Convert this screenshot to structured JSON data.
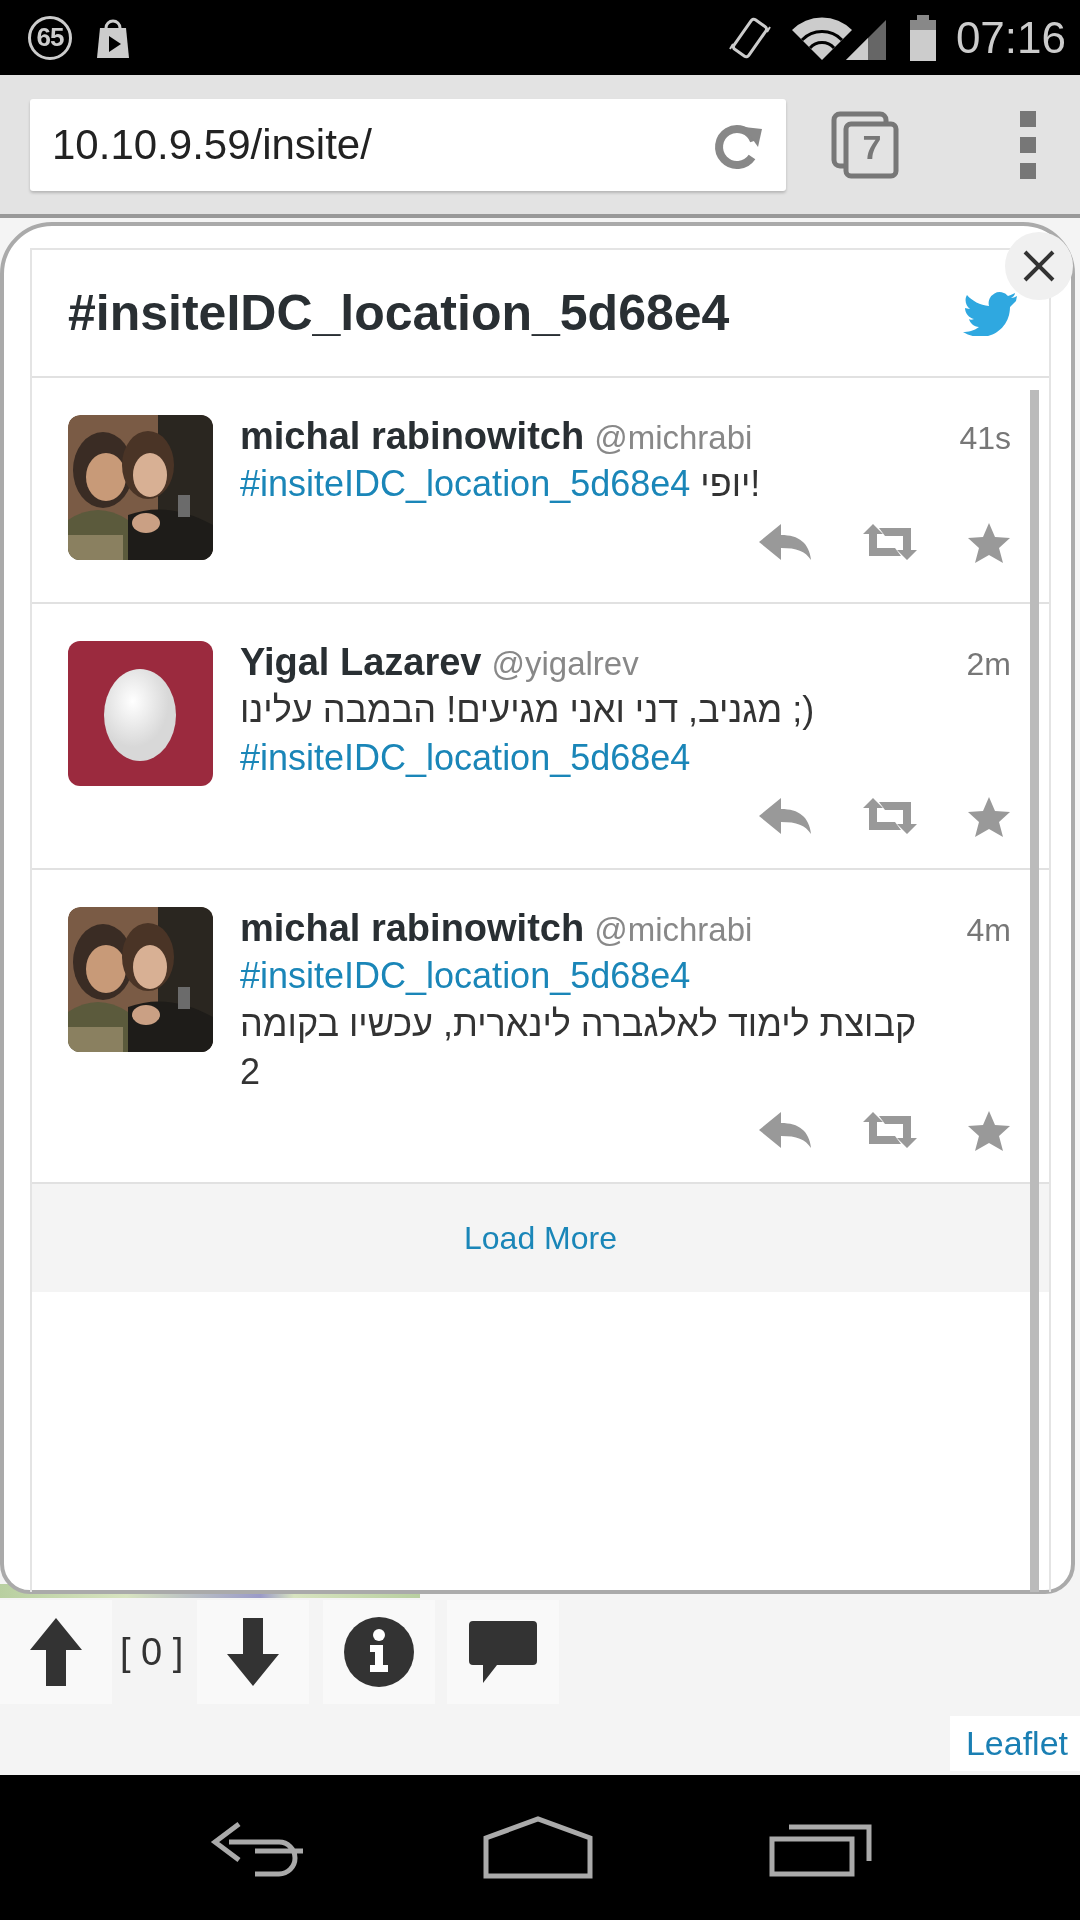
{
  "status_bar": {
    "notification_count": "65",
    "time": "07:16"
  },
  "browser": {
    "url": "10.10.9.59/insite/",
    "tab_count": "7"
  },
  "popup": {
    "title": "#insiteIDC_location_5d68e4",
    "tweets": [
      {
        "author": "michal rabinowitch",
        "handle": "@michrabi",
        "time": "41s",
        "avatar": {
          "kind": "picture"
        },
        "message": [
          {
            "kind": "hashtag",
            "text": "#insiteIDC_location_5d68e4"
          },
          {
            "kind": "text",
            "text": " יופי!"
          }
        ]
      },
      {
        "author": "Yigal Lazarev",
        "handle": "@yigalrev",
        "time": "2m",
        "avatar": {
          "kind": "egg"
        },
        "message": [
          {
            "kind": "text",
            "text": "מגניב, דני ואני מגיעים! הבמבה עלינו ;) "
          },
          {
            "kind": "hashtag",
            "text": "#insiteIDC_location_5d68e4"
          }
        ]
      },
      {
        "author": "michal rabinowitch",
        "handle": "@michrabi",
        "time": "4m",
        "avatar": {
          "kind": "picture"
        },
        "message": [
          {
            "kind": "hashtag",
            "text": "#insiteIDC_location_5d68e4"
          },
          {
            "kind": "text",
            "text": "\n קבוצת לימוד לאלגברה לינארית, עכשיו בקומה 2"
          }
        ]
      }
    ],
    "load_more": "Load More"
  },
  "map_controls": {
    "counter": "[ 0 ]"
  },
  "attribution": "Leaflet"
}
